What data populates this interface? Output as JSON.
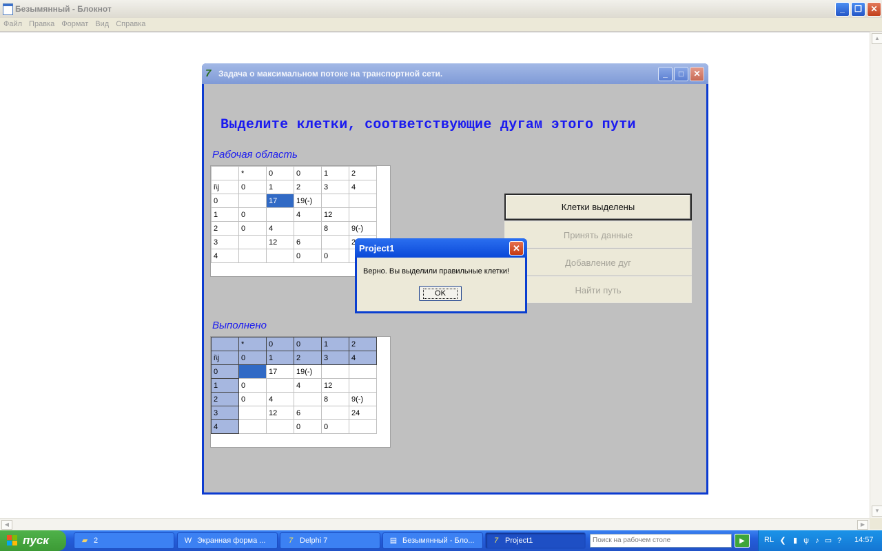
{
  "notepad": {
    "title": "Безымянный - Блокнот",
    "menu": [
      "Файл",
      "Правка",
      "Формат",
      "Вид",
      "Справка"
    ],
    "controls": {
      "minimize": "_",
      "restore": "❐",
      "close": "✕"
    }
  },
  "app": {
    "title": "Задача о максимальном потоке на транспортной сети.",
    "heading": "Выделите клетки, соответствующие дугам этого пути",
    "work_area_label": "Рабочая область",
    "done_label": "Выполнено",
    "grid_work": [
      [
        "",
        "*",
        "0",
        "0",
        "1",
        "2"
      ],
      [
        "i\\j",
        "0",
        "1",
        "2",
        "3",
        "4"
      ],
      [
        "0",
        "",
        "17",
        "19(-)",
        "",
        ""
      ],
      [
        "1",
        "0",
        "",
        "4",
        "12",
        ""
      ],
      [
        "2",
        "0",
        "4",
        "",
        "8",
        "9(-)"
      ],
      [
        "3",
        "",
        "12",
        "6",
        "",
        "24"
      ],
      [
        "4",
        "",
        "",
        "0",
        "0",
        ""
      ]
    ],
    "grid_done": [
      [
        "",
        "*",
        "0",
        "0",
        "1",
        "2"
      ],
      [
        "i\\j",
        "0",
        "1",
        "2",
        "3",
        "4"
      ],
      [
        "0",
        "",
        "17",
        "19(-)",
        "",
        ""
      ],
      [
        "1",
        "0",
        "",
        "4",
        "12",
        ""
      ],
      [
        "2",
        "0",
        "4",
        "",
        "8",
        "9(-)"
      ],
      [
        "3",
        "",
        "12",
        "6",
        "",
        "24"
      ],
      [
        "4",
        "",
        "",
        "0",
        "0",
        ""
      ]
    ],
    "buttons": {
      "cells_selected": "Клетки выделены",
      "accept_data": "Принять данные",
      "add_arcs": "Добавление дуг",
      "find_path": "Найти путь"
    }
  },
  "dialog": {
    "title": "Project1",
    "message": "Верно. Вы выделили правильные клетки!",
    "ok": "OK"
  },
  "taskbar": {
    "start": "пуск",
    "tasks": [
      {
        "label": "2",
        "icon": "folder-icon"
      },
      {
        "label": "Экранная форма ...",
        "icon": "word-icon"
      },
      {
        "label": "Delphi 7",
        "icon": "delphi-icon"
      },
      {
        "label": "Безымянный - Бло...",
        "icon": "notepad-icon"
      },
      {
        "label": "Project1",
        "icon": "delphi-icon"
      }
    ],
    "search_placeholder": "Поиск на рабочем столе",
    "language": "RL",
    "clock": "14:57"
  },
  "colors": {
    "heading": "#1a1af0",
    "selected_cell": "#316ac5",
    "fixed_cell": "#a6b7e0"
  }
}
